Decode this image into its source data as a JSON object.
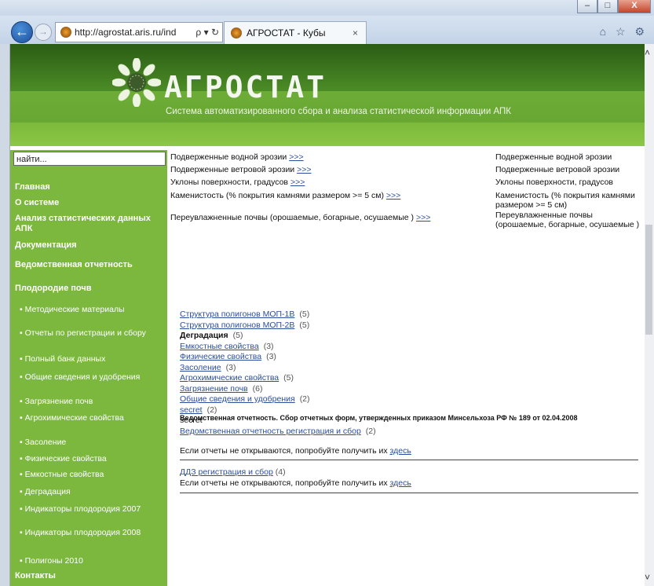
{
  "browser": {
    "url": "http://agrostat.aris.ru/ind",
    "tab_title": "АГРОСТАТ - Кубы",
    "controls": "ρ ▾ ↻",
    "tab_close": "×",
    "toolbar_icons": "⌂ ☆ ⚙",
    "win_min": "–",
    "win_max": "□",
    "win_close": "X"
  },
  "banner": {
    "title": "АГРОСТАТ",
    "subtitle": "Система автоматизированного сбора и анализа статистической информации АПК"
  },
  "sidebar": {
    "search_value": "найти...",
    "items": [
      {
        "label": "Главная",
        "kind": "main"
      },
      {
        "label": "О системе",
        "kind": "main"
      },
      {
        "label": "Анализ статистических данных АПК",
        "kind": "main"
      },
      {
        "label": "Документация",
        "kind": "main"
      },
      {
        "label": "Ведомственная отчетность",
        "kind": "main"
      },
      {
        "label": "Плодородие почв",
        "kind": "main"
      },
      {
        "label": "▪ Методические материалы",
        "kind": "sub"
      },
      {
        "label": "▪ Отчеты по регистрации и сбору",
        "kind": "sub"
      },
      {
        "label": "▪ Полный банк данных",
        "kind": "sub"
      },
      {
        "label": "▪ Общие сведения и удобрения",
        "kind": "sub"
      },
      {
        "label": "▪ Загрязнение почв",
        "kind": "sub"
      },
      {
        "label": "▪ Агрохимические свойства",
        "kind": "sub"
      },
      {
        "label": "▪ Засоление",
        "kind": "sub"
      },
      {
        "label": "▪ Физические свойства",
        "kind": "sub"
      },
      {
        "label": "▪ Емкостные свойства",
        "kind": "sub"
      },
      {
        "label": "▪ Деградация",
        "kind": "sub"
      },
      {
        "label": "▪ Индикаторы плодородия 2007",
        "kind": "sub"
      },
      {
        "label": "▪ Индикаторы плодородия 2008",
        "kind": "sub"
      },
      {
        "label": "▪ Полигоны 2010",
        "kind": "sub"
      },
      {
        "label": "Контакты",
        "kind": "main"
      }
    ]
  },
  "content": {
    "more": ">>>",
    "left_rows": [
      "Подверженные водной эрозии",
      "Подверженные ветровой эрозии",
      "Уклоны поверхности, градусов",
      "Каменистость (% покрытия камнями размером >= 5 см)",
      "Переувлажненные почвы (орошаемые, богарные, осушаемые )"
    ],
    "right_rows": [
      "Подверженные водной эрозии",
      "Подверженные ветровой эрозии",
      "Уклоны поверхности, градусов",
      "Каменистость (% покрытия камнями размером >= 5 см)",
      "Переувлажненные почвы (орошаемые, богарные, осушаемые )"
    ],
    "links": [
      {
        "label": "Структура полигонов МОП-1В",
        "count": "(5)",
        "style": "link"
      },
      {
        "label": "Структура полигонов МОП-2В",
        "count": "(5)",
        "style": "link"
      },
      {
        "label": "Деградация",
        "count": "(5)",
        "style": "bold"
      },
      {
        "label": "Емкостные свойства",
        "count": "(3)",
        "style": "link"
      },
      {
        "label": "Физические свойства",
        "count": "(3)",
        "style": "link"
      },
      {
        "label": "Засоление",
        "count": "(3)",
        "style": "link"
      },
      {
        "label": "Агрохимические свойства",
        "count": "(5)",
        "style": "link"
      },
      {
        "label": "Загрязнение почв",
        "count": "(6)",
        "style": "link"
      },
      {
        "label": "Общие сведения и удобрения",
        "count": "(2)",
        "style": "link"
      },
      {
        "label": "secret",
        "count": "(2)",
        "style": "link"
      },
      {
        "label": "secret",
        "count": "",
        "style": "plain"
      },
      {
        "label": "Ведомственная отчетность регистрация и сбор",
        "count": "(2)",
        "style": "link"
      }
    ],
    "notice": "Ведомственная отчетность. Сбор отчетных форм, утвержденных приказом Минсельхоза РФ № 189 от 02.04.2008",
    "hint_text": "Если отчеты не открываются, попробуйте получить их",
    "hint_link": "здесь",
    "ddz_label": "ДДЗ регистрация и сбор",
    "ddz_count": "(4)"
  }
}
